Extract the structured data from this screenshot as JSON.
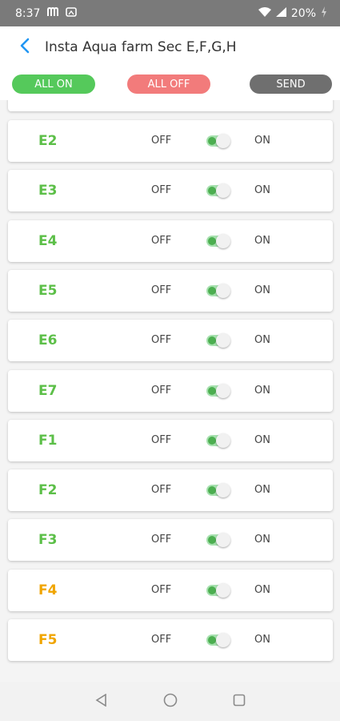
{
  "status_bar": {
    "time": "8:37",
    "battery": "20%",
    "icons": [
      "m-app-icon",
      "gallery-app-icon",
      "wifi-icon",
      "signal-icon",
      "battery-charging-icon"
    ]
  },
  "app_bar": {
    "back_icon": "back-arrow-icon",
    "title": "Insta Aqua farm Sec  E,F,G,H"
  },
  "actions": {
    "all_on": "ALL ON",
    "all_off": "ALL OFF",
    "send": "SEND",
    "colors": {
      "all_on": "#55c95b",
      "all_off": "#f27b7b",
      "send": "#6f6f6f"
    }
  },
  "colors": {
    "green": "#5cbf48",
    "orange": "#f0a500",
    "accent": "#2196f3"
  },
  "labels": {
    "off": "OFF",
    "on": "ON"
  },
  "items": [
    {
      "label": "E2",
      "state": "on",
      "color": "green"
    },
    {
      "label": "E3",
      "state": "on",
      "color": "green"
    },
    {
      "label": "E4",
      "state": "on",
      "color": "green"
    },
    {
      "label": "E5",
      "state": "on",
      "color": "green"
    },
    {
      "label": "E6",
      "state": "on",
      "color": "green"
    },
    {
      "label": "E7",
      "state": "on",
      "color": "green"
    },
    {
      "label": "F1",
      "state": "on",
      "color": "green"
    },
    {
      "label": "F2",
      "state": "on",
      "color": "green"
    },
    {
      "label": "F3",
      "state": "on",
      "color": "green"
    },
    {
      "label": "F4",
      "state": "on",
      "color": "orange"
    },
    {
      "label": "F5",
      "state": "on",
      "color": "orange"
    }
  ],
  "nav_bar": {
    "icons": [
      "back-triangle-icon",
      "home-circle-icon",
      "recents-square-icon"
    ]
  }
}
